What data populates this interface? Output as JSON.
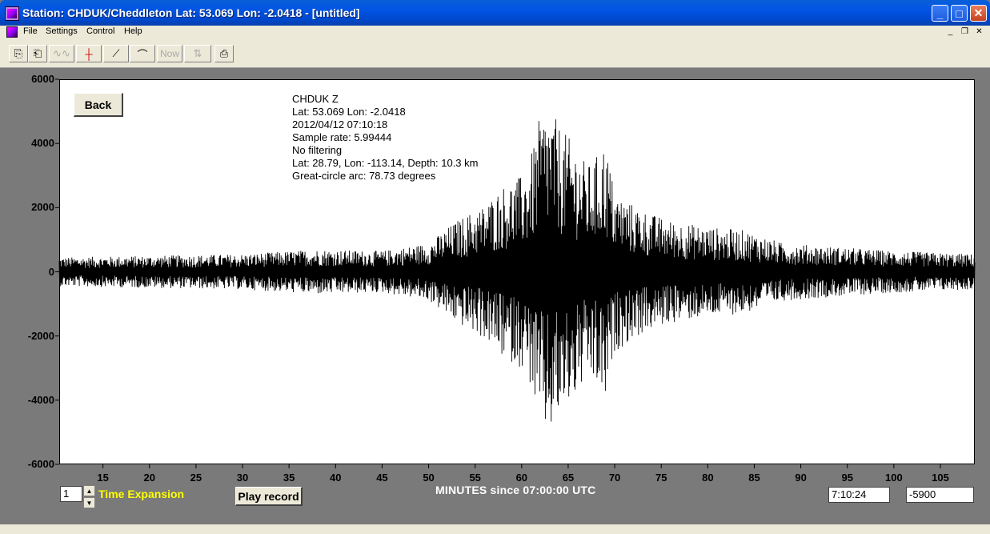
{
  "window": {
    "title": "Station: CHDUK/Cheddleton Lat: 53.069 Lon: -2.0418 - [untitled]",
    "minimize_icon": "minimize-icon",
    "maximize_icon": "maximize-icon",
    "close_icon": "close-icon"
  },
  "menu": {
    "items": [
      "File",
      "Settings",
      "Control",
      "Help"
    ]
  },
  "toolbar": {
    "now_label": "Now"
  },
  "info": {
    "station": "CHDUK  Z",
    "location": "Lat: 53.069 Lon: -2.0418",
    "datetime": "2012/04/12 07:10:18",
    "sample_rate": "Sample rate: 5.99444",
    "filtering": "No filtering",
    "event": "Lat: 28.79, Lon: -113.14, Depth: 10.3 km",
    "arc": "Great-circle arc: 78.73 degrees"
  },
  "buttons": {
    "back": "Back",
    "play_record": "Play record"
  },
  "controls": {
    "time_expansion_value": "1",
    "time_expansion_label": "Time Expansion",
    "time_readout": "7:10:24",
    "value_readout": "-5900"
  },
  "chart_data": {
    "type": "line",
    "xlabel": "MINUTES since 07:00:00 UTC",
    "ylabel": "",
    "xlim": [
      10.3,
      108.7
    ],
    "ylim": [
      -6000,
      6000
    ],
    "yticks": [
      "6000",
      "4000",
      "2000",
      "0",
      "-2000",
      "-4000",
      "-6000"
    ],
    "xticks": [
      "15",
      "20",
      "25",
      "30",
      "35",
      "40",
      "45",
      "50",
      "55",
      "60",
      "65",
      "70",
      "75",
      "80",
      "85",
      "90",
      "95",
      "100",
      "105"
    ],
    "series": [
      {
        "envelope": {
          "x": [
            10.3,
            20,
            30,
            38,
            45,
            50,
            53,
            56,
            58,
            60,
            61,
            62,
            63,
            64,
            65,
            66,
            67,
            68,
            69,
            70,
            72,
            74,
            76,
            78,
            80,
            84,
            88,
            95,
            100,
            108.7
          ],
          "amplitude": [
            450,
            500,
            550,
            700,
            650,
            900,
            1600,
            2100,
            2700,
            3000,
            3600,
            4900,
            5100,
            4600,
            4200,
            3900,
            3300,
            3600,
            4100,
            2500,
            2100,
            1800,
            1600,
            1500,
            1400,
            1300,
            900,
            750,
            650,
            550
          ]
        }
      }
    ]
  }
}
